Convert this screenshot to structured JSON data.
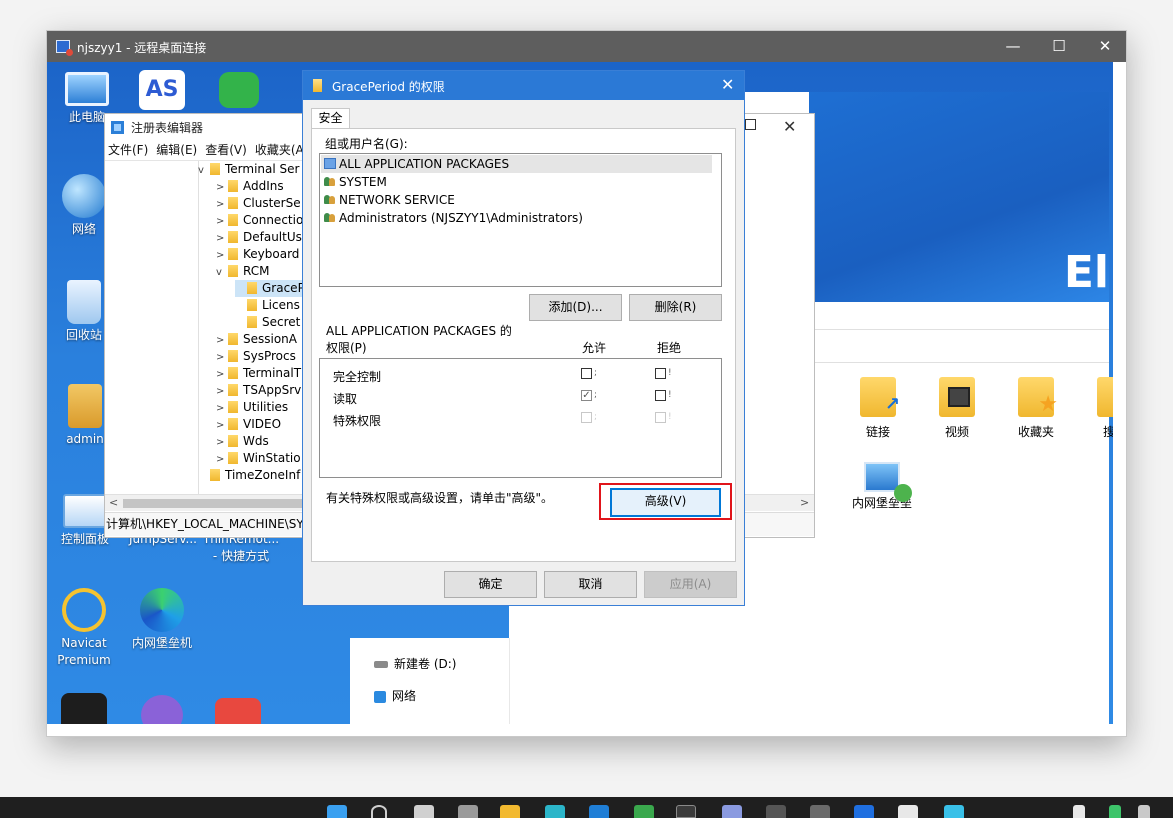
{
  "rdp_window": {
    "title": "njszyy1 - 远程桌面连接",
    "minimize_glyph": "—",
    "maximize_glyph": "☐",
    "close_glyph": "✕"
  },
  "desktop_icons": [
    {
      "label": "此电脑",
      "icon": "monitor-icon"
    },
    {
      "label": "网络",
      "icon": "globe-icon"
    },
    {
      "label": "回收站",
      "icon": "recycle-bin-icon"
    },
    {
      "label": "admin",
      "icon": "user-folder-icon"
    },
    {
      "label": "控制面板",
      "icon": "control-panel-icon"
    },
    {
      "label": "JumpServ...",
      "icon": "app-icon"
    },
    {
      "label": "ThinRemot...",
      "label2": "- 快捷方式",
      "icon": "shortcut-icon"
    },
    {
      "label": "Navicat",
      "label2": "Premium",
      "icon": "navicat-icon"
    },
    {
      "label": "内网堡垒机",
      "icon": "edge-icon"
    }
  ],
  "explorer": {
    "banner_text": "El",
    "folders": [
      {
        "label": "链接",
        "icon": "link-folder-icon"
      },
      {
        "label": "视频",
        "icon": "video-folder-icon"
      },
      {
        "label": "收藏夹",
        "icon": "favorites-folder-icon"
      },
      {
        "label": "搜索",
        "icon": "search-folder-icon"
      }
    ],
    "network_item": "内网堡垒垒",
    "nav_items": [
      "新建卷 (D:)",
      "网络"
    ]
  },
  "regedit": {
    "title": "注册表编辑器",
    "menu": [
      "文件(F)",
      "编辑(E)",
      "查看(V)",
      "收藏夹(A)"
    ],
    "tree": [
      {
        "label": "Terminal Ser",
        "level": 0,
        "arrow": "v"
      },
      {
        "label": "AddIns",
        "level": 1,
        "arrow": ">"
      },
      {
        "label": "ClusterSe",
        "level": 1,
        "arrow": ">"
      },
      {
        "label": "Connectio",
        "level": 1,
        "arrow": ">"
      },
      {
        "label": "DefaultUs",
        "level": 1,
        "arrow": ">"
      },
      {
        "label": "Keyboard",
        "level": 1,
        "arrow": ">"
      },
      {
        "label": "RCM",
        "level": 1,
        "arrow": "v"
      },
      {
        "label": "GraceP",
        "level": 2,
        "arrow": ""
      },
      {
        "label": "Licens",
        "level": 2,
        "arrow": ""
      },
      {
        "label": "Secret",
        "level": 2,
        "arrow": ""
      },
      {
        "label": "SessionA",
        "level": 1,
        "arrow": ">"
      },
      {
        "label": "SysProcs",
        "level": 1,
        "arrow": ">"
      },
      {
        "label": "TerminalT",
        "level": 1,
        "arrow": ">"
      },
      {
        "label": "TSAppSrv",
        "level": 1,
        "arrow": ">"
      },
      {
        "label": "Utilities",
        "level": 1,
        "arrow": ">"
      },
      {
        "label": "VIDEO",
        "level": 1,
        "arrow": ">"
      },
      {
        "label": "Wds",
        "level": 1,
        "arrow": ">"
      },
      {
        "label": "WinStatio",
        "level": 1,
        "arrow": ">"
      },
      {
        "label": "TimeZoneInf",
        "level": 0,
        "arrow": ""
      }
    ],
    "status_path": "计算机\\HKEY_LOCAL_MACHINE\\SY"
  },
  "dialog": {
    "title": "GracePeriod 的权限",
    "close_glyph": "✕",
    "tab": "安全",
    "group_label": "组或用户名(G):",
    "groups": [
      {
        "name": "ALL APPLICATION PACKAGES",
        "icon": "package-icon",
        "selected": true
      },
      {
        "name": "SYSTEM",
        "icon": "users-icon",
        "selected": false
      },
      {
        "name": "NETWORK SERVICE",
        "icon": "users-icon",
        "selected": false
      },
      {
        "name": "Administrators (NJSZYY1\\Administrators)",
        "icon": "users-icon",
        "selected": false
      }
    ],
    "add_button": "添加(D)...",
    "remove_button": "删除(R)",
    "perm_header_line1": "ALL APPLICATION PACKAGES 的",
    "perm_header_line2": "权限(P)",
    "allow_header": "允许",
    "deny_header": "拒绝",
    "permissions": [
      {
        "name": "完全控制",
        "allow": false,
        "deny": false,
        "enabled": true
      },
      {
        "name": "读取",
        "allow": true,
        "deny": false,
        "enabled": true
      },
      {
        "name": "特殊权限",
        "allow": false,
        "deny": false,
        "enabled": false
      }
    ],
    "check_glyph": "✓",
    "advanced_hint": "有关特殊权限或高级设置，请单击\"高级\"。",
    "advanced_button": "高级(V)",
    "ok_button": "确定",
    "cancel_button": "取消",
    "apply_button": "应用(A)"
  }
}
